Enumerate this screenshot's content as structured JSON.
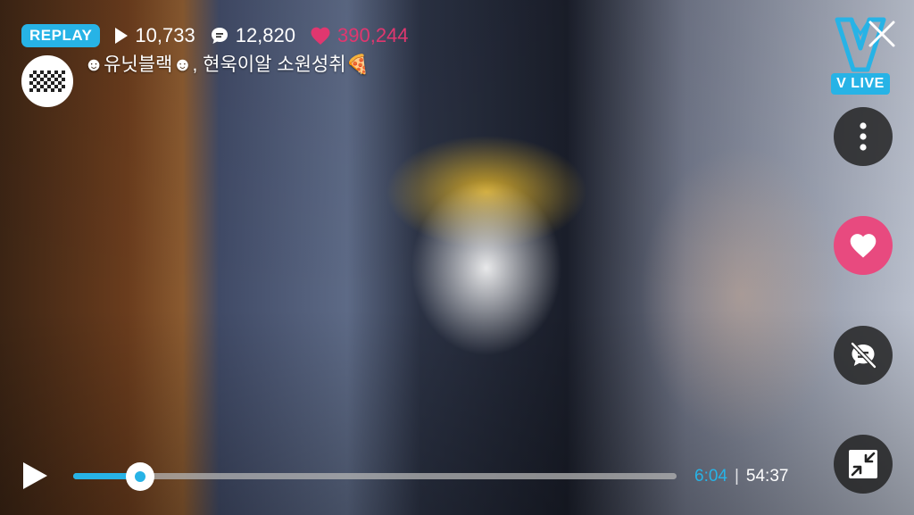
{
  "status": {
    "replay_label": "REPLAY",
    "plays": "10,733",
    "comments": "12,820",
    "likes": "390,244"
  },
  "channel": {
    "title": "☻유닛블랙☻, 현욱이알 소원성취🍕"
  },
  "brand": {
    "logo_label": "V LIVE"
  },
  "player": {
    "current_time": "6:04",
    "separator": "|",
    "total_time": "54:37",
    "progress": 0.111
  },
  "colors": {
    "accent": "#27b3e6",
    "like": "#e0376f",
    "heart_button": "#e84a7f"
  },
  "icons": {
    "play_count": "play-triangle-icon",
    "comments": "chat-bubble-icon",
    "likes": "heart-icon",
    "close": "close-icon",
    "more": "more-vertical-icon",
    "heart_action": "heart-icon",
    "chat_off": "chat-off-icon",
    "minimize": "minimize-arrows-icon",
    "play": "play-icon"
  }
}
